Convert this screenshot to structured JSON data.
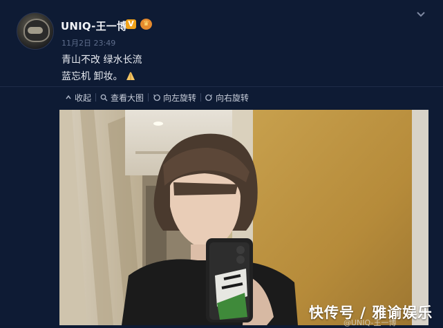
{
  "post": {
    "username": "UNIQ-王一博",
    "timestamp": "11月2日 23:49",
    "text_line1": "青山不改 绿水长流",
    "text_line2": "蓝忘机 卸妆。",
    "badges": {
      "verified": "V",
      "crown": "♛"
    },
    "colors": {
      "background": "#0e1b34",
      "verified_badge": "#f0a21a",
      "crown_badge": "#e58a2d"
    }
  },
  "toolbar": {
    "items": [
      {
        "label": "收起",
        "icon": "collapse-icon"
      },
      {
        "label": "查看大图",
        "icon": "magnifier-icon"
      },
      {
        "label": "向左旋转",
        "icon": "rotate-left-icon"
      },
      {
        "label": "向右旋转",
        "icon": "rotate-right-icon"
      }
    ]
  },
  "image": {
    "watermark": "快传号 / 雅谕娱乐",
    "source_mark": "@UNIQ-王一博"
  }
}
